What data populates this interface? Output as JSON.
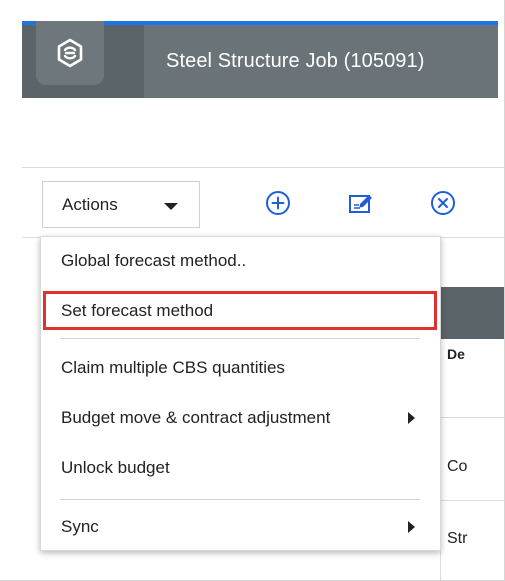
{
  "header": {
    "title": "Steel Structure Job (105091)",
    "logo": "viewpoint-logo-icon"
  },
  "toolbar": {
    "actions_label": "Actions",
    "icons": [
      "add-circle-icon",
      "edit-note-icon",
      "cancel-circle-icon"
    ]
  },
  "menu": {
    "items": [
      {
        "label": "Global forecast method..",
        "submenu": false
      },
      {
        "label": "Set forecast method",
        "submenu": false,
        "highlighted": true
      },
      {
        "label": "Claim multiple CBS quantities",
        "submenu": false
      },
      {
        "label": "Budget move & contract adjustment",
        "submenu": true
      },
      {
        "label": "Unlock budget",
        "submenu": false
      },
      {
        "label": "Sync",
        "submenu": true
      }
    ]
  },
  "table": {
    "header_fragment": "De",
    "row_fragments": [
      "Co",
      "Str"
    ]
  },
  "colors": {
    "header_bg": "#5b6468",
    "accent_blue": "#1e73e8",
    "highlight_red": "#e03131"
  }
}
